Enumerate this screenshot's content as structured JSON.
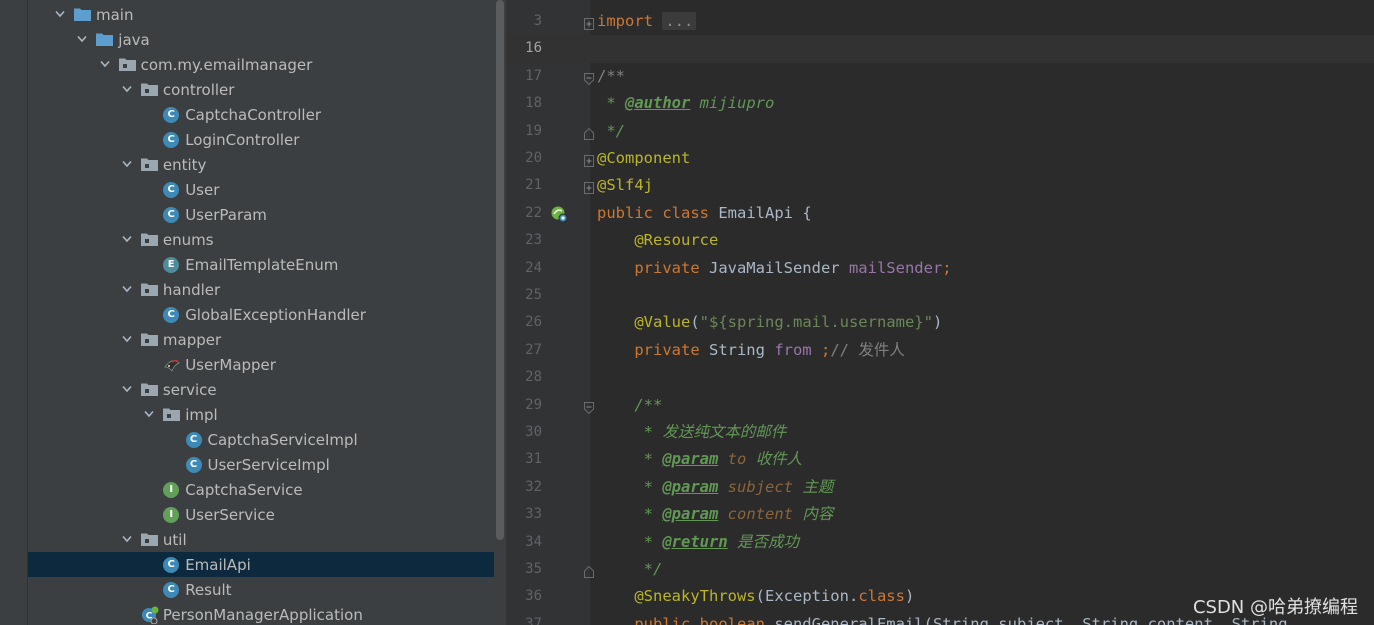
{
  "tree": [
    {
      "label": "main",
      "type": "folder-blue",
      "depth": 0,
      "arrow": true
    },
    {
      "label": "java",
      "type": "folder-blue",
      "depth": 1,
      "arrow": true
    },
    {
      "label": "com.my.emailmanager",
      "type": "package",
      "depth": 2,
      "arrow": true
    },
    {
      "label": "controller",
      "type": "package",
      "depth": 3,
      "arrow": true
    },
    {
      "label": "CaptchaController",
      "type": "class",
      "depth": 4,
      "arrow": false
    },
    {
      "label": "LoginController",
      "type": "class",
      "depth": 4,
      "arrow": false
    },
    {
      "label": "entity",
      "type": "package",
      "depth": 3,
      "arrow": true
    },
    {
      "label": "User",
      "type": "class",
      "depth": 4,
      "arrow": false
    },
    {
      "label": "UserParam",
      "type": "class",
      "depth": 4,
      "arrow": false
    },
    {
      "label": "enums",
      "type": "package",
      "depth": 3,
      "arrow": true
    },
    {
      "label": "EmailTemplateEnum",
      "type": "enum",
      "depth": 4,
      "arrow": false
    },
    {
      "label": "handler",
      "type": "package",
      "depth": 3,
      "arrow": true
    },
    {
      "label": "GlobalExceptionHandler",
      "type": "class",
      "depth": 4,
      "arrow": false
    },
    {
      "label": "mapper",
      "type": "package",
      "depth": 3,
      "arrow": true
    },
    {
      "label": "UserMapper",
      "type": "mapper",
      "depth": 4,
      "arrow": false
    },
    {
      "label": "service",
      "type": "package",
      "depth": 3,
      "arrow": true
    },
    {
      "label": "impl",
      "type": "package",
      "depth": 4,
      "arrow": true
    },
    {
      "label": "CaptchaServiceImpl",
      "type": "class",
      "depth": 5,
      "arrow": false
    },
    {
      "label": "UserServiceImpl",
      "type": "class",
      "depth": 5,
      "arrow": false
    },
    {
      "label": "CaptchaService",
      "type": "interface",
      "depth": 4,
      "arrow": false
    },
    {
      "label": "UserService",
      "type": "interface",
      "depth": 4,
      "arrow": false
    },
    {
      "label": "util",
      "type": "package",
      "depth": 3,
      "arrow": true
    },
    {
      "label": "EmailApi",
      "type": "class",
      "depth": 4,
      "arrow": false,
      "selected": true
    },
    {
      "label": "Result",
      "type": "class",
      "depth": 4,
      "arrow": false
    },
    {
      "label": "PersonManagerApplication",
      "type": "app",
      "depth": 3,
      "arrow": false
    }
  ],
  "icon_letters": {
    "class": "C",
    "interface": "I",
    "enum": "E"
  },
  "editor": {
    "current_line": "16",
    "lines": [
      {
        "n": "3",
        "fold": "plus",
        "tokens": [
          [
            "kw",
            "import"
          ],
          [
            "",
            ""
          ],
          [
            "",
            ""
          ],
          [
            "ph",
            "..."
          ]
        ]
      },
      {
        "n": "16",
        "tokens": []
      },
      {
        "n": "17",
        "fold": "top",
        "tokens": [
          [
            "cmt",
            "/**"
          ]
        ]
      },
      {
        "n": "18",
        "tokens": [
          [
            "doc",
            " * "
          ],
          [
            "doctag",
            "@author"
          ],
          [
            "doc",
            " mijiupro"
          ]
        ]
      },
      {
        "n": "19",
        "fold": "bottom",
        "tokens": [
          [
            "doc",
            " */"
          ]
        ]
      },
      {
        "n": "20",
        "fold": "plus",
        "tokens": [
          [
            "ann",
            "@Component"
          ]
        ]
      },
      {
        "n": "21",
        "fold": "plus",
        "tokens": [
          [
            "ann",
            "@Slf4j"
          ]
        ]
      },
      {
        "n": "22",
        "bean": true,
        "tokens": [
          [
            "kw",
            "public class "
          ],
          [
            "",
            "EmailApi {"
          ]
        ]
      },
      {
        "n": "23",
        "tokens": [
          [
            "",
            "    "
          ],
          [
            "ann",
            "@Resource"
          ]
        ]
      },
      {
        "n": "24",
        "tokens": [
          [
            "",
            "    "
          ],
          [
            "kw",
            "private "
          ],
          [
            "",
            "JavaMailSender "
          ],
          [
            "fld",
            "mailSender"
          ],
          [
            "kw",
            ";"
          ]
        ]
      },
      {
        "n": "25",
        "tokens": []
      },
      {
        "n": "26",
        "tokens": [
          [
            "",
            "    "
          ],
          [
            "ann",
            "@Value"
          ],
          [
            "",
            "("
          ],
          [
            "str",
            "\"${spring.mail.username}\""
          ],
          [
            "",
            ")"
          ]
        ]
      },
      {
        "n": "27",
        "tokens": [
          [
            "",
            "    "
          ],
          [
            "kw",
            "private "
          ],
          [
            "",
            "String "
          ],
          [
            "fld",
            "from "
          ],
          [
            "kw",
            ";"
          ],
          [
            "cmt",
            "// 发件人"
          ]
        ]
      },
      {
        "n": "28",
        "tokens": []
      },
      {
        "n": "29",
        "fold": "top",
        "tokens": [
          [
            "",
            "    "
          ],
          [
            "doc",
            "/**"
          ]
        ]
      },
      {
        "n": "30",
        "tokens": [
          [
            "",
            "    "
          ],
          [
            "doc",
            " * 发送纯文本的邮件"
          ]
        ]
      },
      {
        "n": "31",
        "tokens": [
          [
            "",
            "    "
          ],
          [
            "doc",
            " * "
          ],
          [
            "doctag",
            "@param"
          ],
          [
            "docval",
            " to"
          ],
          [
            "doc",
            " 收件人"
          ]
        ]
      },
      {
        "n": "32",
        "tokens": [
          [
            "",
            "    "
          ],
          [
            "doc",
            " * "
          ],
          [
            "doctag",
            "@param"
          ],
          [
            "docval",
            " subject"
          ],
          [
            "doc",
            " 主题"
          ]
        ]
      },
      {
        "n": "33",
        "tokens": [
          [
            "",
            "    "
          ],
          [
            "doc",
            " * "
          ],
          [
            "doctag",
            "@param"
          ],
          [
            "docval",
            " content"
          ],
          [
            "doc",
            " 内容"
          ]
        ]
      },
      {
        "n": "34",
        "tokens": [
          [
            "",
            "    "
          ],
          [
            "doc",
            " * "
          ],
          [
            "doctag",
            "@return"
          ],
          [
            "doc",
            " 是否成功"
          ]
        ]
      },
      {
        "n": "35",
        "fold": "bottom",
        "tokens": [
          [
            "",
            "    "
          ],
          [
            "doc",
            " */"
          ]
        ]
      },
      {
        "n": "36",
        "tokens": [
          [
            "",
            "    "
          ],
          [
            "ann",
            "@SneakyThrows"
          ],
          [
            "",
            "(Exception."
          ],
          [
            "kw",
            "class"
          ],
          [
            "",
            ")"
          ]
        ]
      },
      {
        "n": "37",
        "tokens": [
          [
            "",
            "    "
          ],
          [
            "kw",
            "public boolean "
          ],
          [
            "",
            "sendGeneralEmail(String subject, String content, String"
          ]
        ]
      }
    ]
  },
  "watermark": "CSDN @哈弟撩编程"
}
